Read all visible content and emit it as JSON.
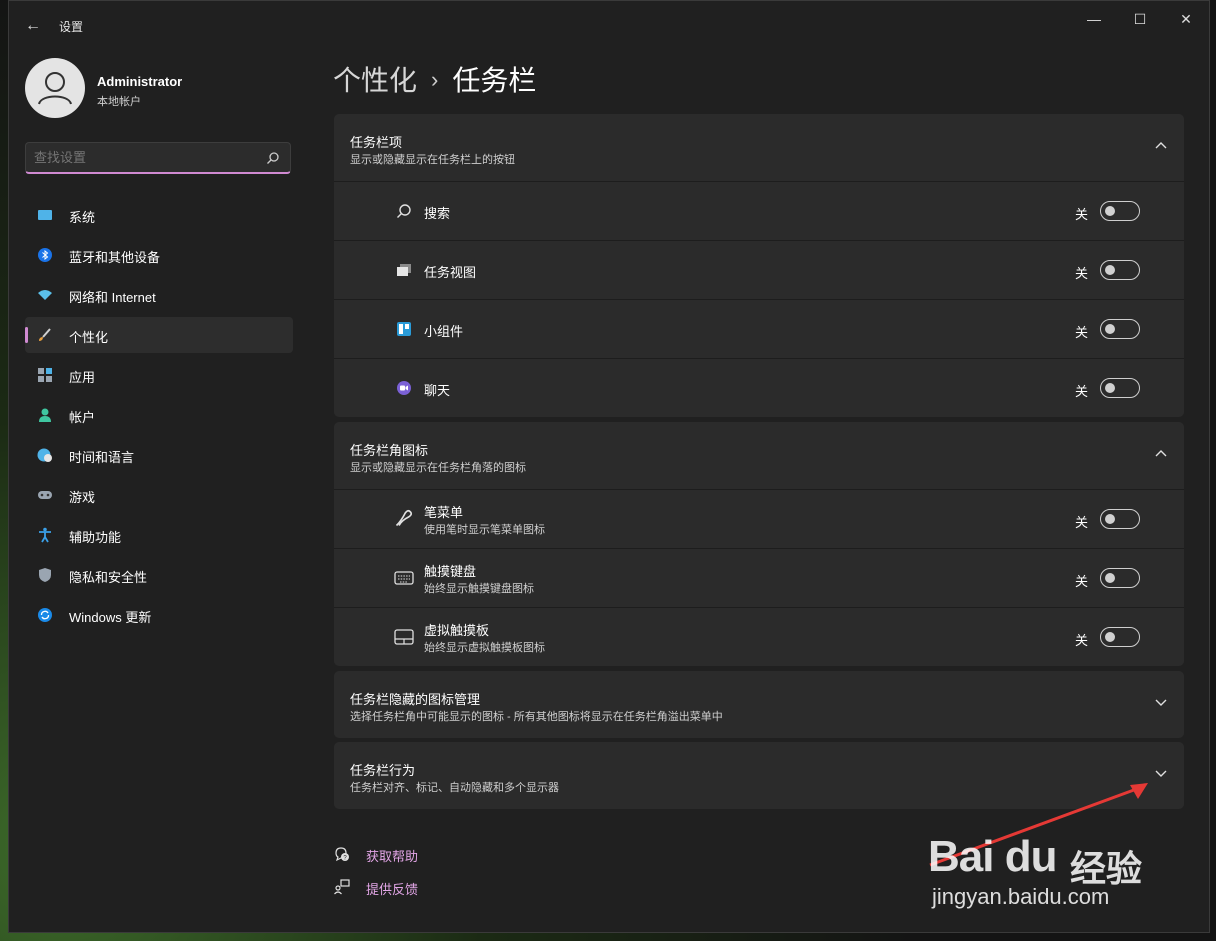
{
  "window": {
    "title": "设置",
    "back": "←",
    "minimize": "—",
    "maximize": "☐",
    "close": "✕"
  },
  "user": {
    "name": "Administrator",
    "type": "本地帐户"
  },
  "search": {
    "placeholder": "查找设置"
  },
  "nav": [
    {
      "label": "系统",
      "icon": "monitor-icon"
    },
    {
      "label": "蓝牙和其他设备",
      "icon": "bluetooth-icon"
    },
    {
      "label": "网络和 Internet",
      "icon": "wifi-icon"
    },
    {
      "label": "个性化",
      "icon": "brush-icon",
      "active": true
    },
    {
      "label": "应用",
      "icon": "apps-icon"
    },
    {
      "label": "帐户",
      "icon": "person-icon"
    },
    {
      "label": "时间和语言",
      "icon": "globe-clock-icon"
    },
    {
      "label": "游戏",
      "icon": "gamepad-icon"
    },
    {
      "label": "辅助功能",
      "icon": "accessibility-icon"
    },
    {
      "label": "隐私和安全性",
      "icon": "shield-icon"
    },
    {
      "label": "Windows 更新",
      "icon": "update-icon"
    }
  ],
  "breadcrumb": {
    "parent": "个性化",
    "separator": "›",
    "current": "任务栏"
  },
  "taskbar_items": {
    "title": "任务栏项",
    "subtitle": "显示或隐藏显示在任务栏上的按钮",
    "rows": [
      {
        "label": "搜索",
        "state": "关",
        "icon": "search-icon"
      },
      {
        "label": "任务视图",
        "state": "关",
        "icon": "task-view-icon"
      },
      {
        "label": "小组件",
        "state": "关",
        "icon": "widgets-icon"
      },
      {
        "label": "聊天",
        "state": "关",
        "icon": "chat-icon"
      }
    ]
  },
  "corner_icons": {
    "title": "任务栏角图标",
    "subtitle": "显示或隐藏显示在任务栏角落的图标",
    "rows": [
      {
        "label": "笔菜单",
        "sub": "使用笔时显示笔菜单图标",
        "state": "关",
        "icon": "pen-icon"
      },
      {
        "label": "触摸键盘",
        "sub": "始终显示触摸键盘图标",
        "state": "关",
        "icon": "keyboard-icon"
      },
      {
        "label": "虚拟触摸板",
        "sub": "始终显示虚拟触摸板图标",
        "state": "关",
        "icon": "touchpad-icon"
      }
    ]
  },
  "hidden_icons": {
    "title": "任务栏隐藏的图标管理",
    "subtitle": "选择任务栏角中可能显示的图标 - 所有其他图标将显示在任务栏角溢出菜单中"
  },
  "behaviors": {
    "title": "任务栏行为",
    "subtitle": "任务栏对齐、标记、自动隐藏和多个显示器"
  },
  "links": {
    "help": "获取帮助",
    "feedback": "提供反馈"
  },
  "watermark": {
    "logo": "Bai du",
    "cn": "经验",
    "url": "jingyan.baidu.com"
  },
  "colors": {
    "accent": "#d08ad2",
    "link": "#e3a6e7",
    "card": "#2b2b2b",
    "window": "#202020",
    "arrow": "#e53935"
  }
}
